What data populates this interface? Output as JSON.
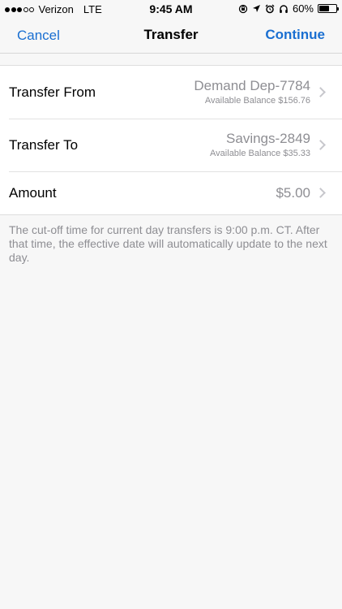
{
  "status_bar": {
    "signal_dots_full": 3,
    "signal_dots_total": 5,
    "carrier": "Verizon",
    "network": "LTE",
    "time": "9:45 AM",
    "battery_percent": "60%",
    "battery_level": 0.6,
    "icons": [
      "lock-rotation-icon",
      "location-arrow-icon",
      "alarm-icon",
      "headphones-icon",
      "battery-icon"
    ]
  },
  "nav": {
    "cancel_label": "Cancel",
    "title": "Transfer",
    "continue_label": "Continue"
  },
  "form": {
    "transfer_from": {
      "label": "Transfer From",
      "account": "Demand Dep-7784",
      "balance": "Available Balance $156.76"
    },
    "transfer_to": {
      "label": "Transfer To",
      "account": "Savings-2849",
      "balance": "Available Balance $35.33"
    },
    "amount": {
      "label": "Amount",
      "value": "$5.00"
    }
  },
  "footnote": "The cut-off time for current day transfers is 9:00 p.m. CT. After that time, the effective date will automatically update to the next day.",
  "colors": {
    "accent": "#1a6fd1",
    "secondary_text": "#8e8e93",
    "background": "#f7f7f7"
  }
}
